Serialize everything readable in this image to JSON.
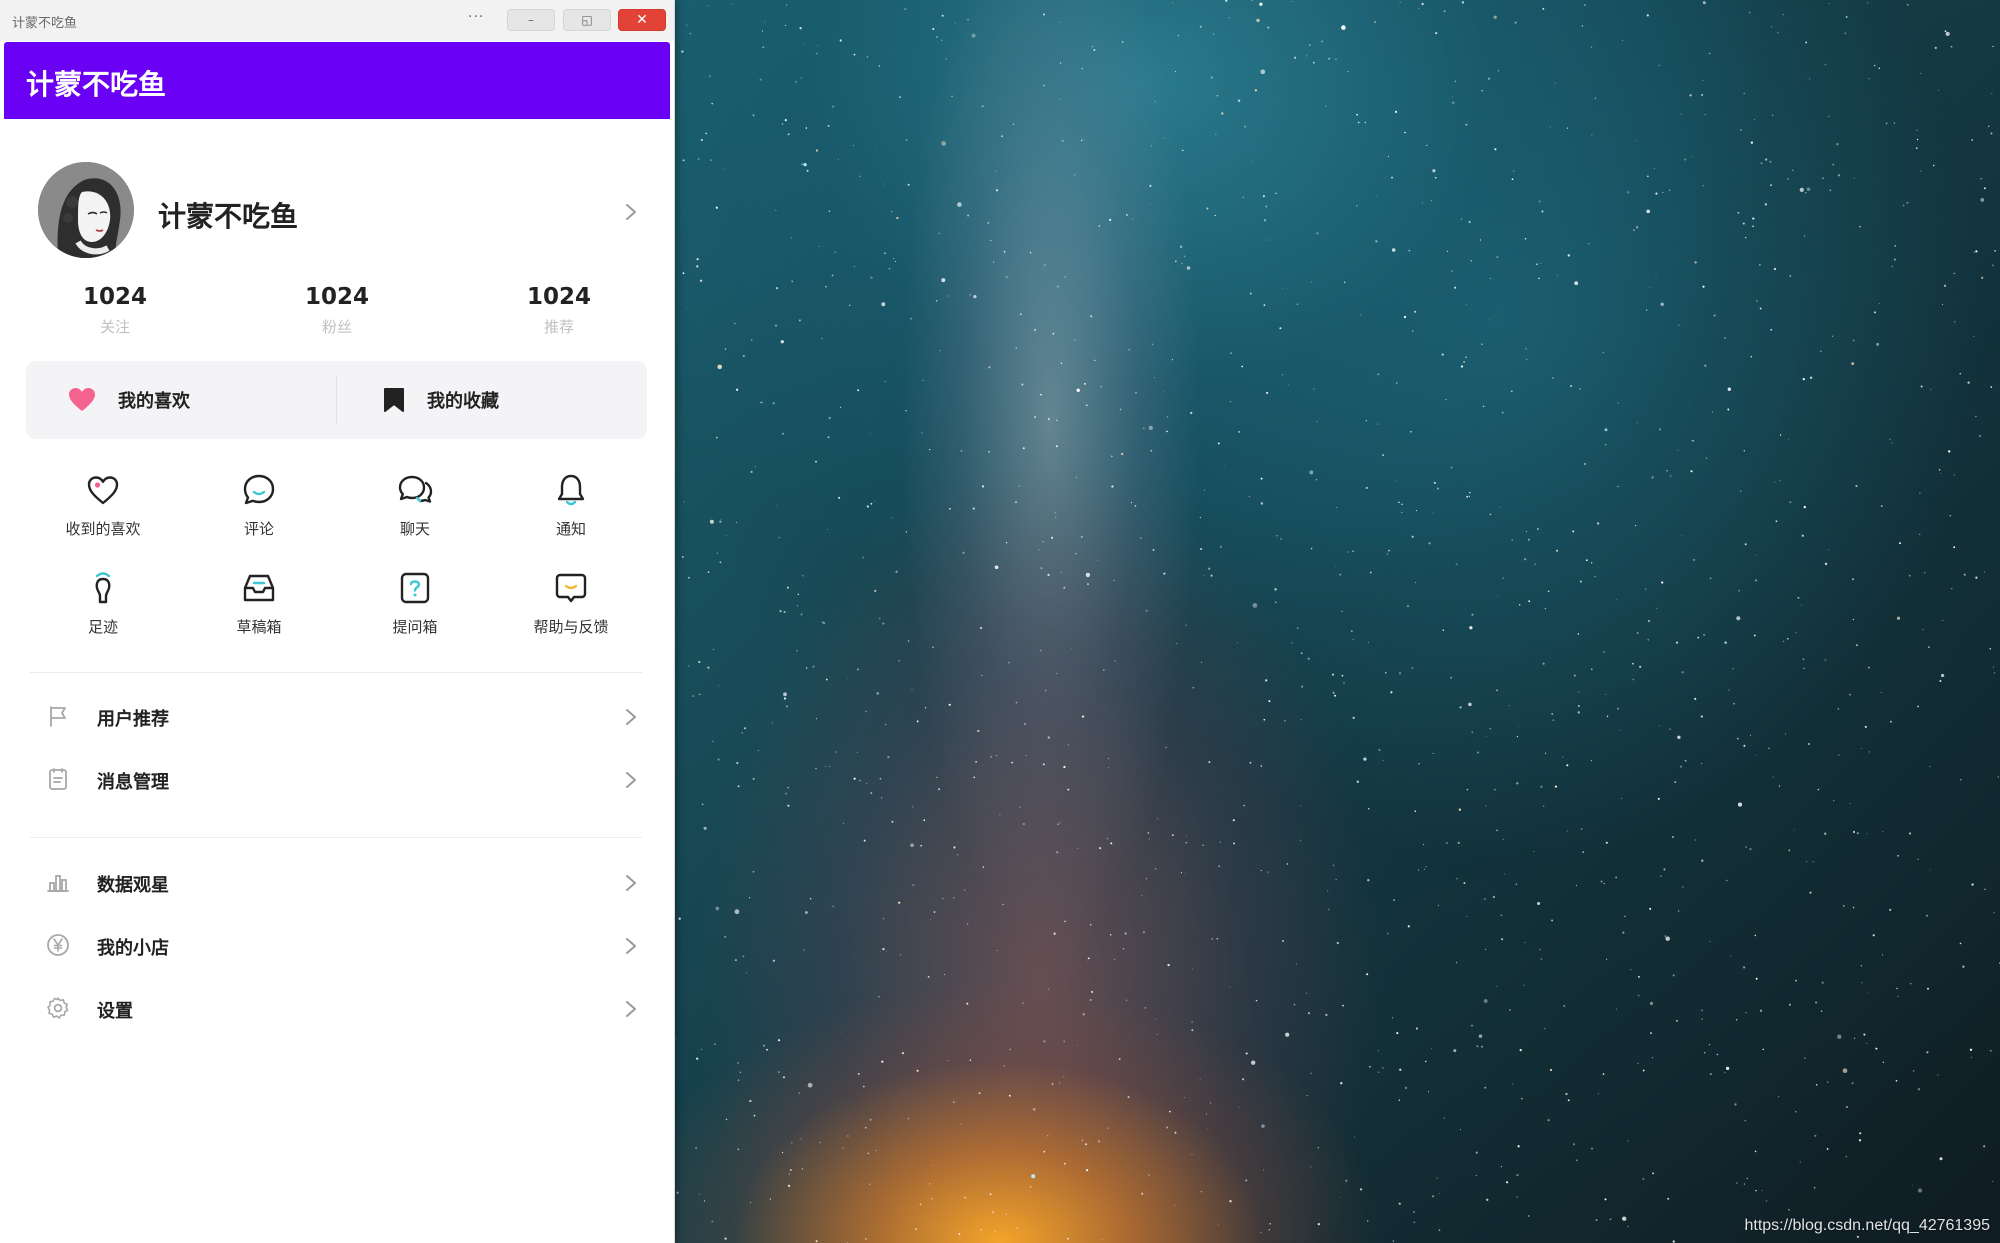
{
  "window": {
    "title": "计蒙不吃鱼",
    "more_label": "···",
    "minimize_label": "–",
    "restore_label": "◱",
    "close_label": "✕"
  },
  "header": {
    "title": "计蒙不吃鱼",
    "color": "#6a00f4"
  },
  "profile": {
    "name": "计蒙不吃鱼",
    "avatar_icon": "avatar-illustration"
  },
  "stats": [
    {
      "value": "1024",
      "label": "关注"
    },
    {
      "value": "1024",
      "label": "粉丝"
    },
    {
      "value": "1024",
      "label": "推荐"
    }
  ],
  "favorites": [
    {
      "label": "我的喜欢",
      "icon": "heart-filled-icon",
      "color": "#f4638f"
    },
    {
      "label": "我的收藏",
      "icon": "bookmark-icon",
      "color": "#222222"
    }
  ],
  "grid": [
    {
      "label": "收到的喜欢",
      "icon": "heart-outline-icon"
    },
    {
      "label": "评论",
      "icon": "comment-icon"
    },
    {
      "label": "聊天",
      "icon": "chat-icon"
    },
    {
      "label": "通知",
      "icon": "bell-icon"
    },
    {
      "label": "足迹",
      "icon": "footprint-icon"
    },
    {
      "label": "草稿箱",
      "icon": "inbox-icon"
    },
    {
      "label": "提问箱",
      "icon": "question-icon"
    },
    {
      "label": "帮助与反馈",
      "icon": "feedback-icon"
    }
  ],
  "menu_group_1": [
    {
      "label": "用户推荐",
      "icon": "flag-icon"
    },
    {
      "label": "消息管理",
      "icon": "clipboard-icon"
    }
  ],
  "menu_group_2": [
    {
      "label": "数据观星",
      "icon": "bar-chart-icon"
    },
    {
      "label": "我的小店",
      "icon": "yen-icon"
    },
    {
      "label": "设置",
      "icon": "gear-icon"
    }
  ],
  "accent_colors": {
    "teal": "#3ec6d6",
    "heart_pink": "#f4638f",
    "close_red": "#e24336"
  },
  "watermark": "https://blog.csdn.net/qq_42761395"
}
